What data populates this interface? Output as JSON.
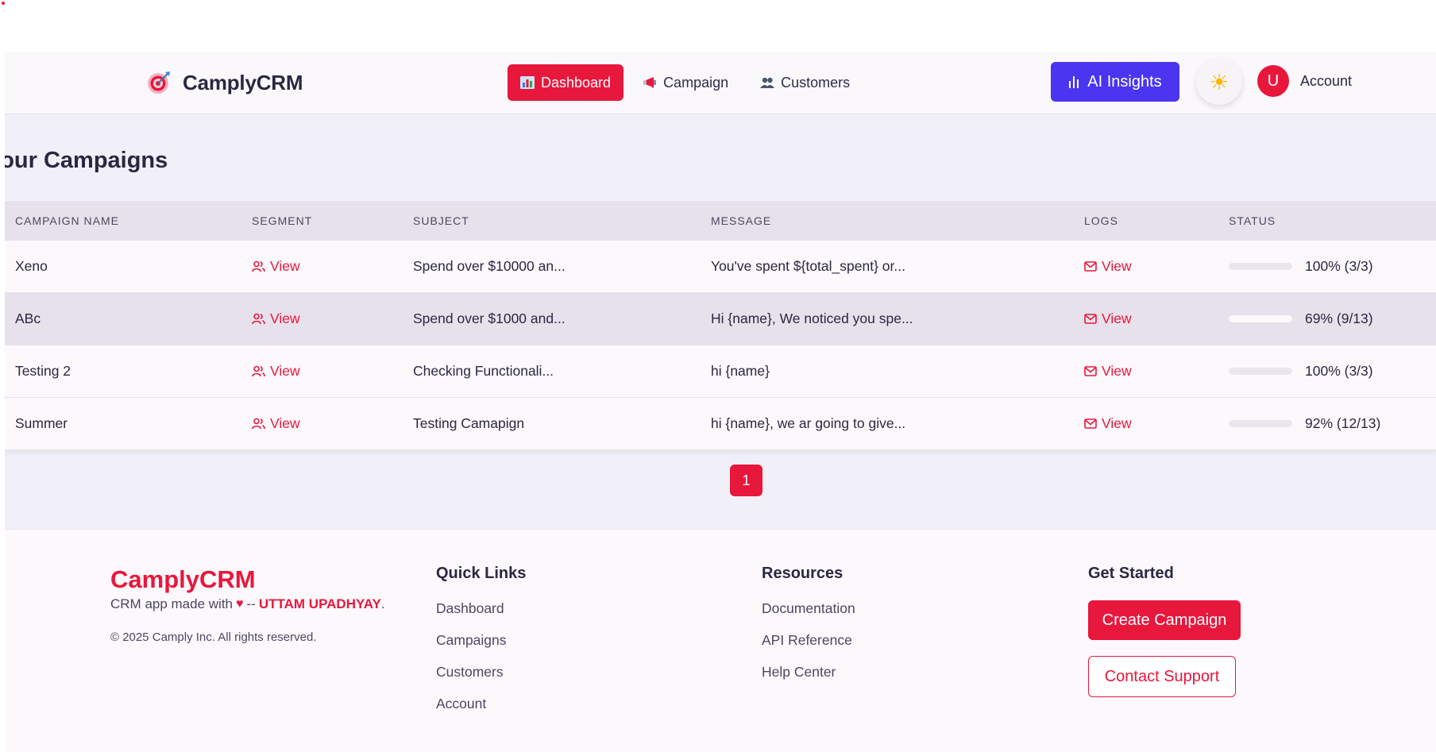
{
  "header": {
    "brand": "CamplyCRM",
    "nav": [
      {
        "label": "Dashboard",
        "icon": "bar-chart-icon",
        "active": true
      },
      {
        "label": "Campaign",
        "icon": "megaphone-icon",
        "active": false
      },
      {
        "label": "Customers",
        "icon": "users-icon",
        "active": false
      }
    ],
    "ai_label": "AI Insights",
    "theme_icon": "☀",
    "avatar_initial": "U",
    "account_label": "Account"
  },
  "main": {
    "title": "Your Campaigns",
    "columns": [
      "CAMPAIGN NAME",
      "SEGMENT",
      "SUBJECT",
      "MESSAGE",
      "LOGS",
      "STATUS"
    ],
    "rows": [
      {
        "name": "Xeno",
        "segment": "View",
        "subject": "Spend over $10000 an...",
        "message": "You've spent ${total_spent} or...",
        "logs": "View",
        "progress": 1.0,
        "status": "100% (3/3)"
      },
      {
        "name": "ABc",
        "segment": "View",
        "subject": "Spend over $1000 and...",
        "message": "Hi {name}, We noticed you spe...",
        "logs": "View",
        "progress": 0.69,
        "status": "69% (9/13)"
      },
      {
        "name": "Testing 2",
        "segment": "View",
        "subject": "Checking Functionali...",
        "message": "hi {name}",
        "logs": "View",
        "progress": 1.0,
        "status": "100% (3/3)"
      },
      {
        "name": "Summer",
        "segment": "View",
        "subject": "Testing Camapign",
        "message": "hi {name}, we ar going to give...",
        "logs": "View",
        "progress": 0.92,
        "status": "92% (12/13)"
      }
    ],
    "page": "1"
  },
  "footer": {
    "brand": "CamplyCRM",
    "tagline_prefix": "CRM app made with",
    "tagline_sep": "--",
    "author": "UTTAM UPADHYAY",
    "tagline_end": ".",
    "copyright": "© 2025 Camply Inc. All rights reserved.",
    "quick_links_title": "Quick Links",
    "quick_links": [
      "Dashboard",
      "Campaigns",
      "Customers",
      "Account"
    ],
    "resources_title": "Resources",
    "resources": [
      "Documentation",
      "API Reference",
      "Help Center"
    ],
    "get_started_title": "Get Started",
    "create_label": "Create Campaign",
    "support_label": "Contact Support"
  },
  "colors": {
    "accent": "#e8173c",
    "ai": "#4a35f0",
    "header_bg": "#fbf8fc",
    "page_bg": "#f1f0f9"
  }
}
